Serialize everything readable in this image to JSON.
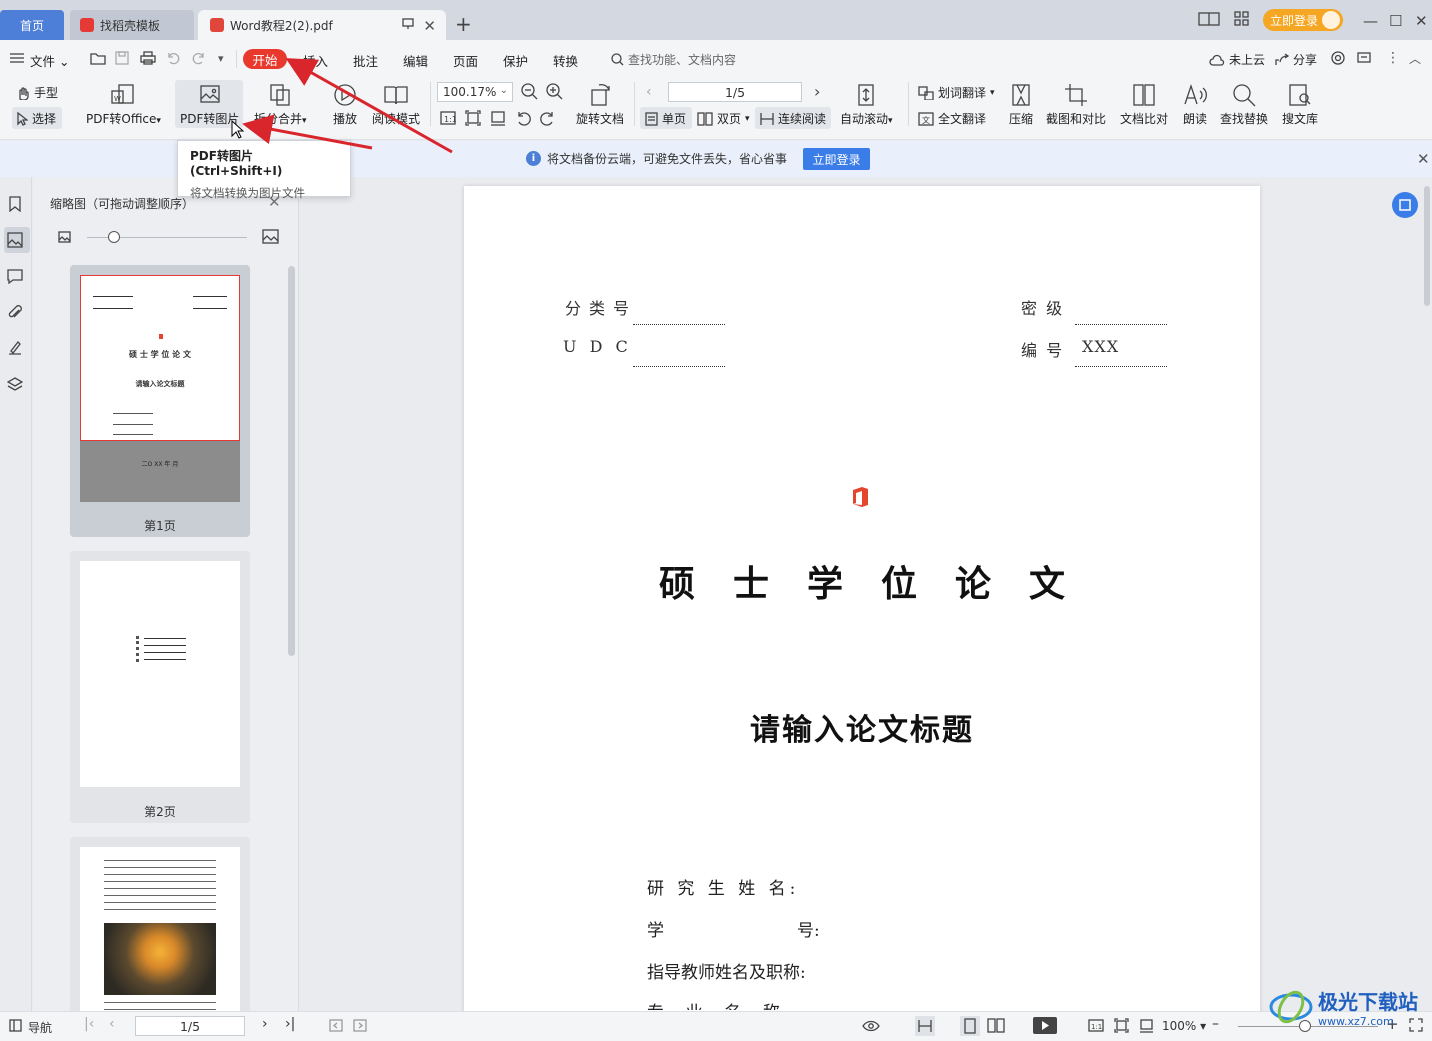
{
  "tabs": {
    "home": "首页",
    "docer": "找稻壳模板",
    "document": "Word教程2(2).pdf"
  },
  "title_bar": {
    "login": "立即登录"
  },
  "menu": {
    "file": "文件",
    "start": "开始",
    "insert": "插入",
    "annotate": "批注",
    "edit": "编辑",
    "page": "页面",
    "protect": "保护",
    "convert": "转换",
    "search_placeholder": "查找功能、文档内容",
    "cloud": "未上云",
    "share": "分享"
  },
  "ribbon": {
    "hand": "手型",
    "select": "选择",
    "pdf_to_office": "PDF转Office",
    "pdf_to_image": "PDF转图片",
    "split_merge": "拆分合并",
    "play": "播放",
    "read_mode": "阅读模式",
    "zoom": "100.17%",
    "rotate_doc": "旋转文档",
    "page_indicator": "1/5",
    "single_page": "单页",
    "double_page": "双页",
    "continuous": "连续阅读",
    "auto_scroll": "自动滚动",
    "word_translate": "划词翻译",
    "full_translate": "全文翻译",
    "compress": "压缩",
    "screenshot_compare": "截图和对比",
    "doc_compare": "文档比对",
    "read_aloud": "朗读",
    "find_replace": "查找替换",
    "search_library": "搜文库"
  },
  "tooltip": {
    "title": "PDF转图片 (Ctrl+Shift+I)",
    "desc": "将文档转换为图片文件"
  },
  "notification": {
    "text": "将文档备份云端，可避免文件丢失，省心省事",
    "button": "立即登录"
  },
  "thumbnails": {
    "title": "缩略图（可拖动调整顺序）",
    "pages": [
      {
        "label": "第1页"
      },
      {
        "label": "第2页"
      },
      {
        "label": ""
      }
    ],
    "page1_title": "硕 士 学 位 论 文",
    "page1_subtitle": "请输入论文标题",
    "page1_date": "二O XX 年   月"
  },
  "document": {
    "class_no_label": "分类号",
    "secret_label": "密  级",
    "udc_label": "U D C",
    "number_label": "编  号",
    "number_value": "XXX",
    "title": "硕士学位论文",
    "subtitle": "请输入论文标题",
    "fields": {
      "student_name": "研 究 生 姓 名:",
      "student_id_a": "学",
      "student_id_b": "号:",
      "advisor": "指导教师姓名及职称:",
      "major": "专    业    名    称:"
    }
  },
  "status_bar": {
    "nav": "导航",
    "page": "1/5",
    "zoom": "100%"
  },
  "watermark": {
    "name": "极光下载站",
    "url": "www.xz7.com"
  },
  "colors": {
    "accent": "#3b7de8",
    "start_tab": "#e8392c",
    "arrow": "#d9262c",
    "login_pill": "#f5a623"
  }
}
